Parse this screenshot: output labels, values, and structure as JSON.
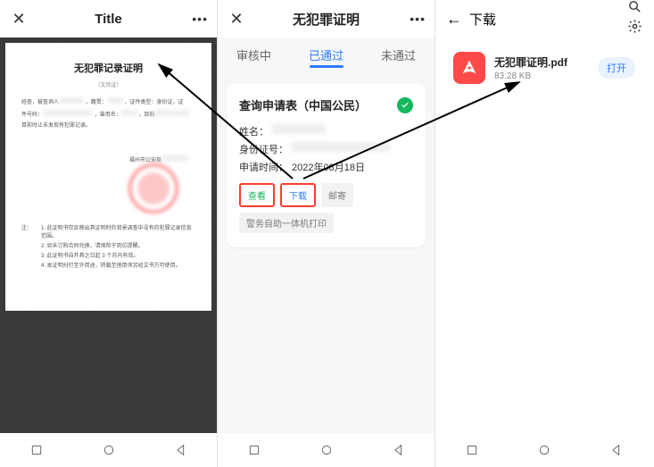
{
  "phone1": {
    "header": {
      "close": "✕",
      "title": "Title",
      "more": "•••"
    },
    "doc": {
      "title": "无犯罪记录证明",
      "sub": "（文凭证）",
      "line1_a": "经查，被查询人",
      "line1_b": "，籍贯：",
      "line1_c": "，证件类型：身份证，证",
      "line2_a": "件号码：",
      "line2_b": "，曾用名：",
      "line2_c": "，目前",
      "line3": "目前时止未发现有犯罪记录。",
      "issuer": "福州市公安局",
      "notes_label": "注：",
      "note1": "1. 此证明书仅反映出具证明时的背景调查中没有的犯罪记录信息范围。",
      "note2": "2. 如未订购合同兑换，请保险于到位提醒。",
      "note3": "3. 此证明书自开具之日起 3 个月内有效。",
      "note4": "4. 本证明扫打至许用途，转载至他用须另经文书方可使用。"
    }
  },
  "phone2": {
    "header": {
      "close": "✕",
      "title": "无犯罪证明",
      "more": "•••"
    },
    "tabs": [
      "审核中",
      "已通过",
      "未通过"
    ],
    "card": {
      "title": "查询申请表（中国公民）",
      "name_label": "姓名：",
      "id_label": "身份证号：",
      "apply_label": "申请时间：",
      "apply_value": "2022年08月18日",
      "btn_view": "查看",
      "btn_download": "下载",
      "btn_mail": "邮寄",
      "btn_print": "警务自助一体机打印"
    }
  },
  "phone3": {
    "header": {
      "title": "下载"
    },
    "file": {
      "name": "无犯罪证明.pdf",
      "size": "83.28 KB",
      "open": "打开"
    }
  }
}
